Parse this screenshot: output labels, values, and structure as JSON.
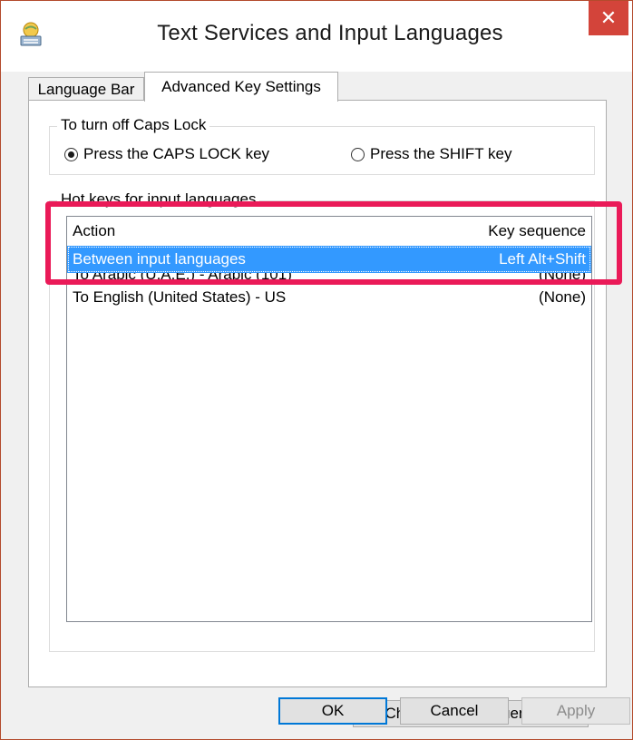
{
  "window": {
    "title": "Text Services and Input Languages",
    "close_label": "✕",
    "accent": "#d3443a"
  },
  "tabs": [
    {
      "label": "Language Bar",
      "active": false
    },
    {
      "label": "Advanced Key Settings",
      "active": true
    }
  ],
  "caps_lock": {
    "legend": "To turn off Caps Lock",
    "options": [
      {
        "label": "Press the CAPS LOCK key",
        "selected": true
      },
      {
        "label": "Press the SHIFT key",
        "selected": false
      }
    ]
  },
  "hot_keys": {
    "legend": "Hot keys for input languages",
    "columns": {
      "action": "Action",
      "key_sequence": "Key sequence"
    },
    "rows": [
      {
        "action": "Between input languages",
        "key": "Left Alt+Shift",
        "selected": true
      },
      {
        "action": "To Arabic (U.A.E.) - Arabic (101)",
        "key": "(None)",
        "selected": false
      },
      {
        "action": "To English (United States) - US",
        "key": "(None)",
        "selected": false
      }
    ],
    "change_button": "Change Key Sequence..."
  },
  "buttons": {
    "ok": "OK",
    "cancel": "Cancel",
    "apply": "Apply"
  },
  "annotation": {
    "color": "#ea1a58"
  }
}
